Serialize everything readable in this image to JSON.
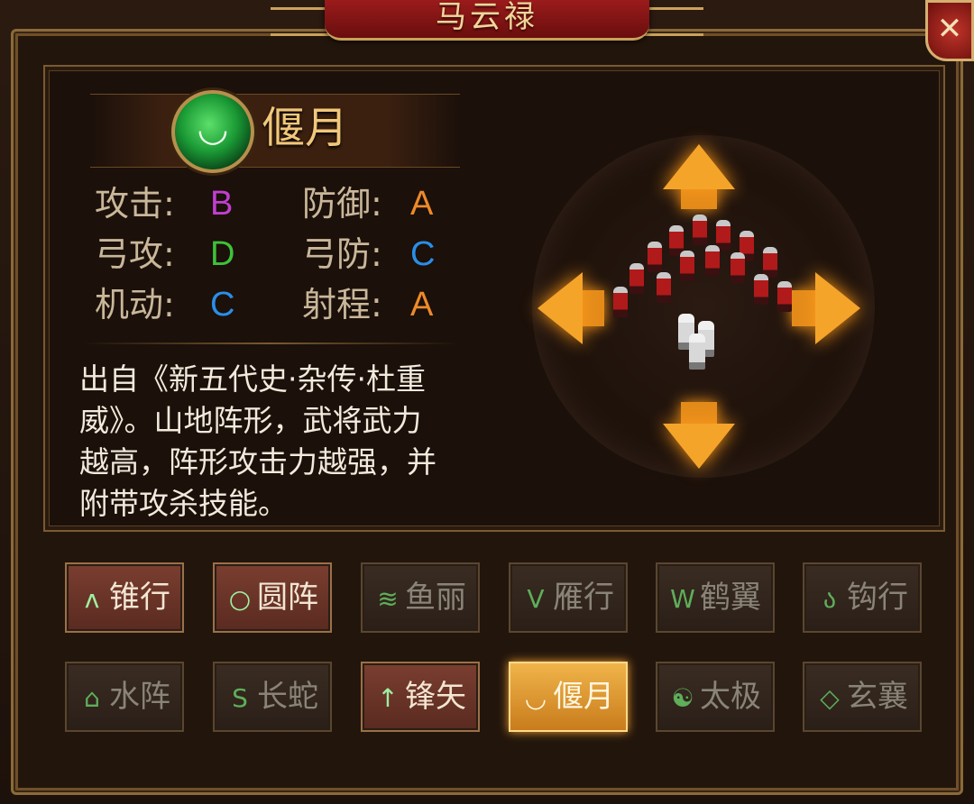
{
  "window": {
    "title": "马云禄",
    "close_label": "✕"
  },
  "formation": {
    "name": "偃月",
    "icon": "crescent-moon-icon",
    "stats": [
      {
        "label": "攻击:",
        "value": "B",
        "color": "#c23fd0"
      },
      {
        "label": "防御:",
        "value": "A",
        "color": "#ee8a2a"
      },
      {
        "label": "弓攻:",
        "value": "D",
        "color": "#3ec23a"
      },
      {
        "label": "弓防:",
        "value": "C",
        "color": "#2a8ee8"
      },
      {
        "label": "机动:",
        "value": "C",
        "color": "#2a8ee8"
      },
      {
        "label": "射程:",
        "value": "A",
        "color": "#ee8a2a"
      }
    ],
    "description_lines": [
      "出自《新五代史·杂传·杜重",
      "威》。山地阵形，武将武力",
      "越高，阵形攻击力越强，并",
      "附带攻杀技能。"
    ]
  },
  "formations": [
    {
      "label": "锥行",
      "icon": "ʌ",
      "state": "enabled"
    },
    {
      "label": "圆阵",
      "icon": "○",
      "state": "enabled"
    },
    {
      "label": "鱼丽",
      "icon": "≋",
      "state": "disabled"
    },
    {
      "label": "雁行",
      "icon": "V",
      "state": "disabled"
    },
    {
      "label": "鹤翼",
      "icon": "W",
      "state": "disabled"
    },
    {
      "label": "钩行",
      "icon": "ა",
      "state": "disabled"
    },
    {
      "label": "水阵",
      "icon": "⌂",
      "state": "disabled"
    },
    {
      "label": "长蛇",
      "icon": "S",
      "state": "disabled"
    },
    {
      "label": "锋矢",
      "icon": "↑",
      "state": "enabled"
    },
    {
      "label": "偃月",
      "icon": "◡",
      "state": "selected"
    },
    {
      "label": "太极",
      "icon": "☯",
      "state": "disabled"
    },
    {
      "label": "玄襄",
      "icon": "◇",
      "state": "disabled"
    }
  ]
}
